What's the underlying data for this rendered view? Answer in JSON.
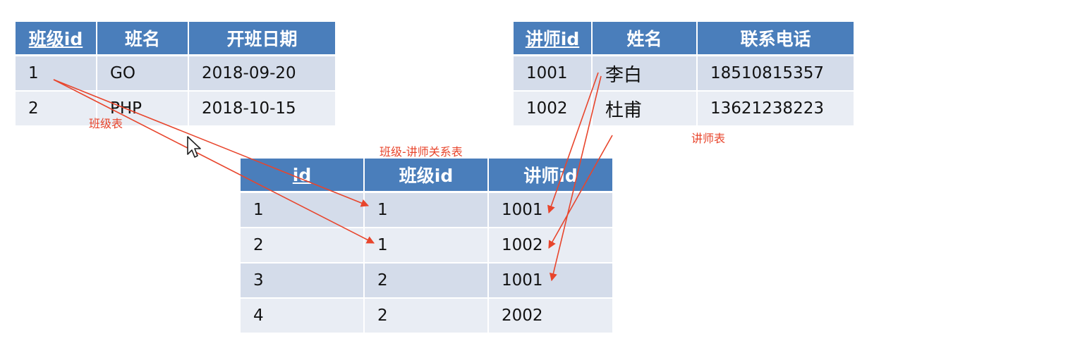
{
  "class_table": {
    "label": "班级表",
    "headers": [
      "班级id",
      "班名",
      "开班日期"
    ],
    "rows": [
      [
        "1",
        "GO",
        "2018-09-20"
      ],
      [
        "2",
        "PHP",
        "2018-10-15"
      ]
    ]
  },
  "teacher_table": {
    "label": "讲师表",
    "headers": [
      "讲师id",
      "姓名",
      "联系电话"
    ],
    "rows": [
      [
        "1001",
        "李白",
        "18510815357"
      ],
      [
        "1002",
        "杜甫",
        "13621238223"
      ]
    ]
  },
  "relation_table": {
    "label": "班级-讲师关系表",
    "headers": [
      "id",
      "班级id",
      "讲师id"
    ],
    "rows": [
      [
        "1",
        "1",
        "1001"
      ],
      [
        "2",
        "1",
        "1002"
      ],
      [
        "3",
        "2",
        "1001"
      ],
      [
        "4",
        "2",
        "2002"
      ]
    ]
  },
  "colors": {
    "header_bg": "#4a7ebb",
    "row_odd": "#d4dcea",
    "row_even": "#e9edf4",
    "arrow": "#e8452c"
  },
  "icons": {
    "cursor": "mouse-pointer-icon",
    "arrow": "arrow-icon"
  }
}
